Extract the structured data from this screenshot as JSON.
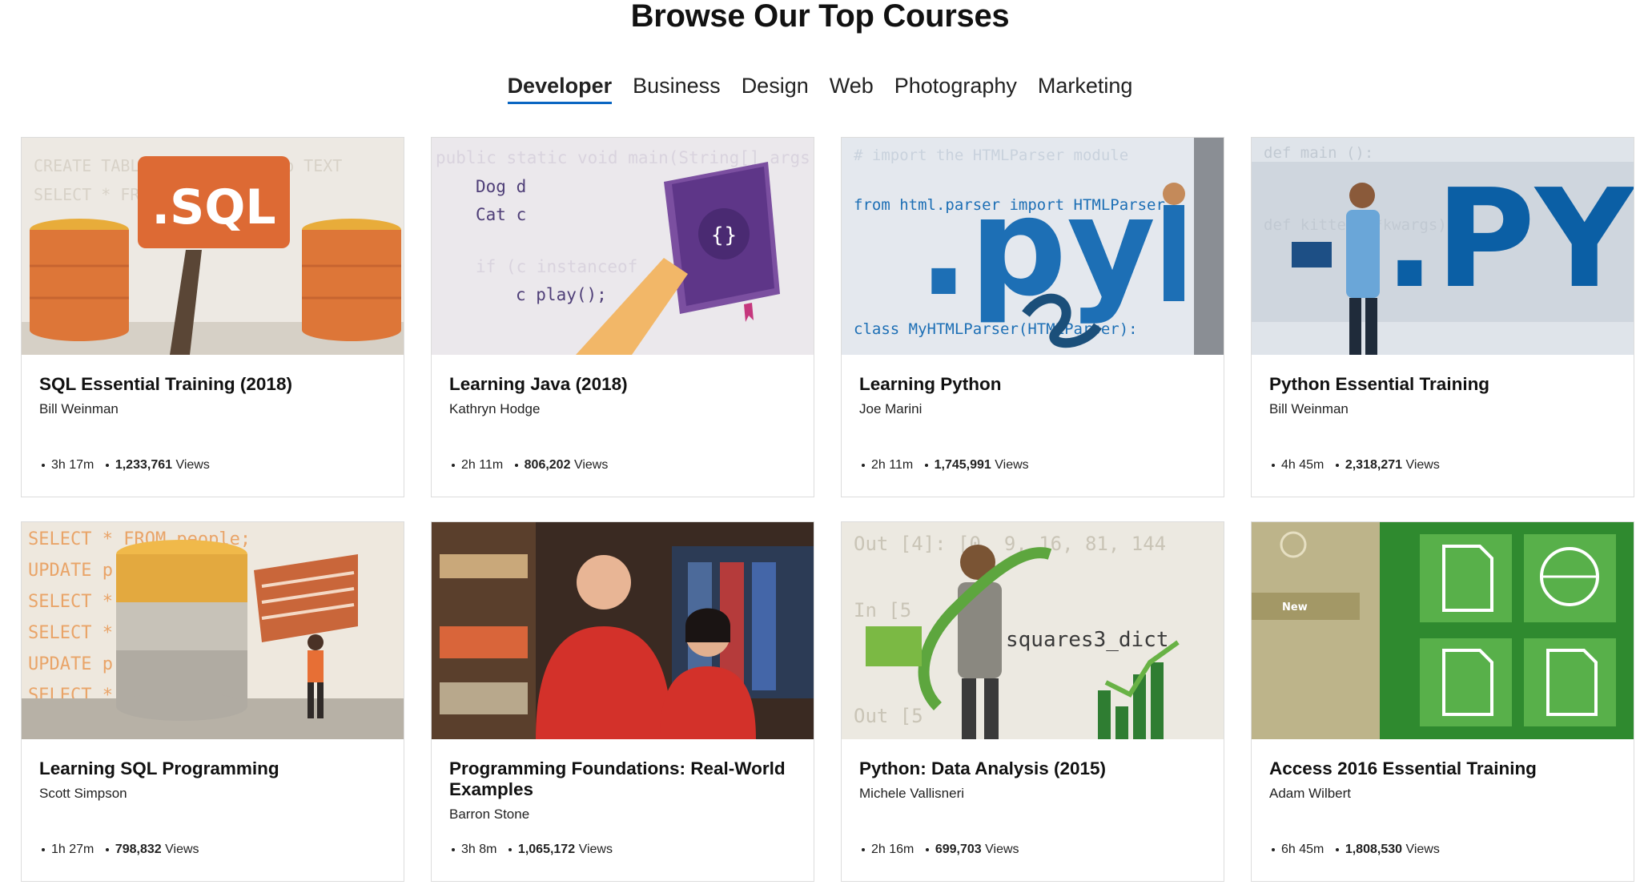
{
  "page": {
    "title": "Browse Our Top Courses"
  },
  "tabs": [
    {
      "label": "Developer",
      "active": true
    },
    {
      "label": "Business",
      "active": false
    },
    {
      "label": "Design",
      "active": false
    },
    {
      "label": "Web",
      "active": false
    },
    {
      "label": "Photography",
      "active": false
    },
    {
      "label": "Marketing",
      "active": false
    }
  ],
  "courses": [
    {
      "title": "SQL Essential Training (2018)",
      "author": "Bill Weinman",
      "duration": "3h 17m",
      "views": "1,233,761",
      "views_label": "Views",
      "thumb_text": ".SQL",
      "thumb_icon": "sql-database-icon"
    },
    {
      "title": "Learning Java (2018)",
      "author": "Kathryn Hodge",
      "duration": "2h 11m",
      "views": "806,202",
      "views_label": "Views",
      "thumb_text": "public static void main(String[] args",
      "thumb_icon": "java-book-icon"
    },
    {
      "title": "Learning Python",
      "author": "Joe Marini",
      "duration": "2h 11m",
      "views": "1,745,991",
      "views_label": "Views",
      "thumb_text": ".py",
      "thumb_icon": "python-snake-icon"
    },
    {
      "title": "Python Essential Training",
      "author": "Bill Weinman",
      "duration": "4h 45m",
      "views": "2,318,271",
      "views_label": "Views",
      "thumb_text": ".PY",
      "thumb_icon": "python-person-icon"
    },
    {
      "title": "Learning SQL Programming",
      "author": "Scott Simpson",
      "duration": "1h 27m",
      "views": "798,832",
      "views_label": "Views",
      "thumb_text": "SELECT * FROM people;",
      "thumb_icon": "database-stack-icon"
    },
    {
      "title": "Programming Foundations: Real-World Examples",
      "author": "Barron Stone",
      "duration": "3h 8m",
      "views": "1,065,172",
      "views_label": "Views",
      "thumb_text": "",
      "thumb_icon": "instructors-photo"
    },
    {
      "title": "Python: Data Analysis (2015)",
      "author": "Michele Vallisneri",
      "duration": "2h 16m",
      "views": "699,703",
      "views_label": "Views",
      "thumb_text": "squares3_dict",
      "thumb_icon": "data-analysis-icon"
    },
    {
      "title": "Access 2016 Essential Training",
      "author": "Adam Wilbert",
      "duration": "6h 45m",
      "views": "1,808,530",
      "views_label": "Views",
      "thumb_text": "New",
      "thumb_icon": "access-templates-icon"
    }
  ],
  "colors": {
    "tab_underline": "#0a66c2",
    "sql_orange": "#e07a3b",
    "python_blue": "#1d6fb5",
    "access_green": "#3c8b35"
  }
}
